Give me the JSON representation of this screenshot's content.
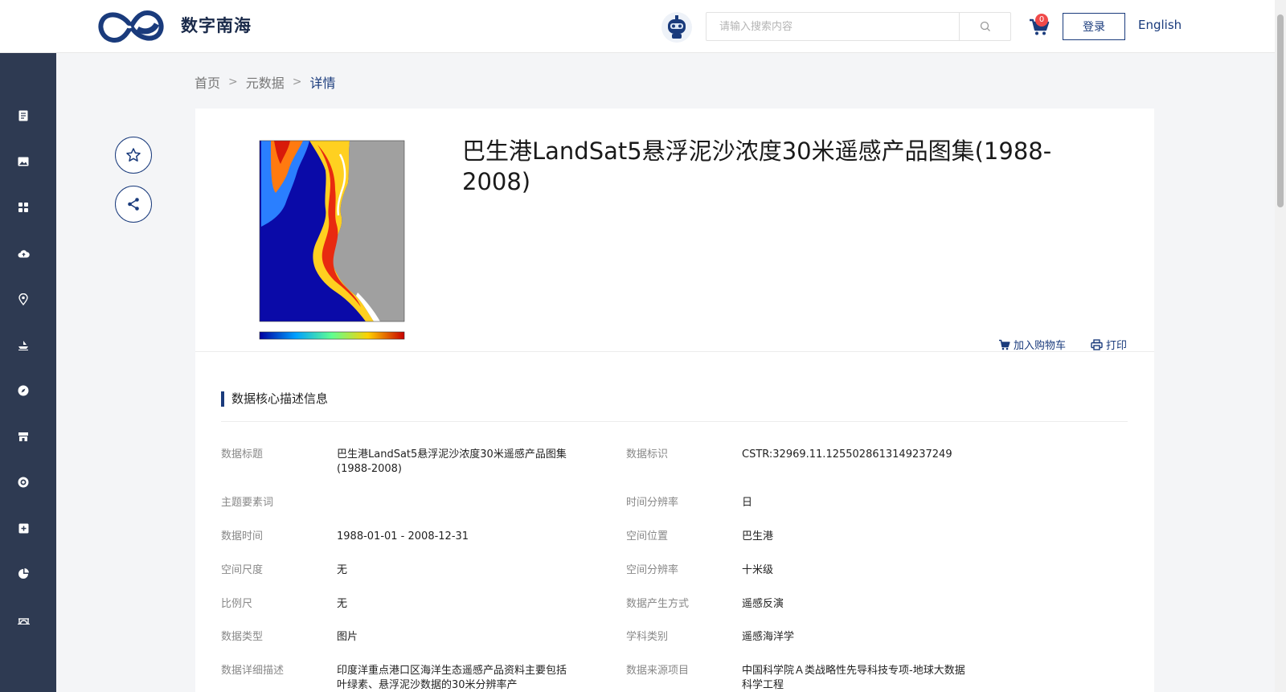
{
  "header": {
    "site_name": "数字南海",
    "search_placeholder": "请输入搜索内容",
    "cart_count": "0",
    "login_label": "登录",
    "lang_label": "English"
  },
  "sidebar": {
    "icons": [
      "document-icon",
      "image-icon",
      "grid-icon",
      "cloud-upload-icon",
      "location-pin-icon",
      "ship-icon",
      "compass-icon",
      "store-icon",
      "target-icon",
      "add-box-icon",
      "pie-chart-icon",
      "bridge-icon"
    ]
  },
  "breadcrumb": {
    "home": "首页",
    "metadata": "元数据",
    "current": "详情"
  },
  "detail": {
    "title": "巴生港LandSat5悬浮泥沙浓度30米遥感产品图集(1988-2008)",
    "add_to_cart": "加入购物车",
    "print": "打印"
  },
  "section": {
    "title": "数据核心描述信息",
    "fields_left": [
      {
        "label": "数据标题",
        "value": "巴生港LandSat5悬浮泥沙浓度30米遥感产品图集(1988-2008)"
      },
      {
        "label": "主题要素词",
        "value": ""
      },
      {
        "label": "数据时间",
        "value": "1988-01-01 - 2008-12-31"
      },
      {
        "label": "空间尺度",
        "value": "无"
      },
      {
        "label": "比例尺",
        "value": "无"
      },
      {
        "label": "数据类型",
        "value": "图片"
      },
      {
        "label": "数据详细描述",
        "value": "印度洋重点港口区海洋生态遥感产品资料主要包括叶绿素、悬浮泥沙数据的30米分辨率产"
      }
    ],
    "fields_right": [
      {
        "label": "数据标识",
        "value": "CSTR:32969.11.1255028613149237249"
      },
      {
        "label": "时间分辨率",
        "value": "日"
      },
      {
        "label": "空间位置",
        "value": "巴生港"
      },
      {
        "label": "空间分辨率",
        "value": "十米级"
      },
      {
        "label": "数据产生方式",
        "value": "遥感反演"
      },
      {
        "label": "学科类别",
        "value": "遥感海洋学"
      },
      {
        "label": "数据来源项目",
        "value": "中国科学院Ａ类战略性先导科技专项-地球大数据科学工程"
      }
    ]
  },
  "colors": {
    "brand": "#1a3b7c",
    "sidebar": "#2e3a52",
    "badge": "#f04a4a"
  }
}
